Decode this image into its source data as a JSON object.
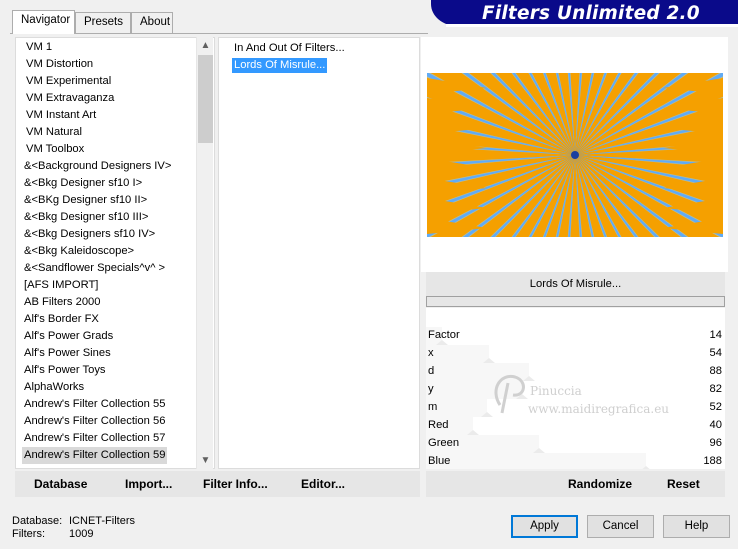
{
  "tabs": [
    "Navigator",
    "Presets",
    "About"
  ],
  "app_title": "Filters Unlimited 2.0",
  "categories": [
    "VM 1",
    "VM Distortion",
    "VM Experimental",
    "VM Extravaganza",
    "VM Instant Art",
    "VM Natural",
    "VM Toolbox",
    "&<Background Designers IV>",
    "&<Bkg Designer sf10 I>",
    "&<BKg Designer sf10 II>",
    "&<Bkg Designer sf10 III>",
    "&<Bkg Designers sf10 IV>",
    "&<Bkg Kaleidoscope>",
    "&<Sandflower Specials^v^ >",
    "[AFS IMPORT]",
    "AB Filters 2000",
    "Alf's Border FX",
    "Alf's Power Grads",
    "Alf's Power Sines",
    "Alf's Power Toys",
    "AlphaWorks",
    "Andrew's Filter Collection 55",
    "Andrew's Filter Collection 56",
    "Andrew's Filter Collection 57",
    "Andrew's Filter Collection 59"
  ],
  "selected_category": "Andrew's Filter Collection 59",
  "filters": [
    "In And Out Of Filters...",
    "Lords Of Misrule..."
  ],
  "selected_filter": "Lords Of Misrule...",
  "filter_name": "Lords Of Misrule...",
  "params": [
    {
      "label": "Factor",
      "value": "14"
    },
    {
      "label": "x",
      "value": "54"
    },
    {
      "label": "d",
      "value": "88"
    },
    {
      "label": "y",
      "value": "82"
    },
    {
      "label": "m",
      "value": "52"
    },
    {
      "label": "Red",
      "value": "40"
    },
    {
      "label": "Green",
      "value": "96"
    },
    {
      "label": "Blue",
      "value": "188"
    }
  ],
  "bottom_buttons": {
    "database": "Database",
    "import": "Import...",
    "filter_info": "Filter Info...",
    "editor": "Editor..."
  },
  "right_buttons": {
    "randomize": "Randomize",
    "reset": "Reset"
  },
  "footer": {
    "database_label": "Database:",
    "database_value": "ICNET-Filters",
    "filters_label": "Filters:",
    "filters_value": "1009"
  },
  "dialog_buttons": {
    "apply": "Apply",
    "cancel": "Cancel",
    "help": "Help"
  },
  "watermark": {
    "line1": "Pinuccia",
    "line2": "www.maidiregrafica.eu"
  },
  "colors": {
    "banner": "#0a0a8a",
    "selection": "#3399ff",
    "preview_blue": "#1a74e8",
    "preview_orange": "#f5a000"
  },
  "icons": {
    "scroll_up": "▲",
    "scroll_down": "▼"
  }
}
